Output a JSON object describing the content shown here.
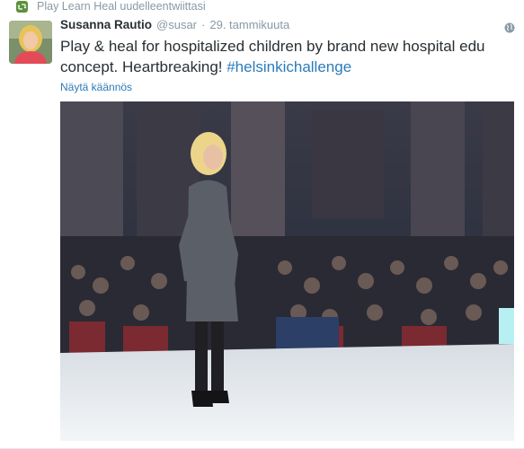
{
  "retweet": {
    "text": "Play Learn Heal uudelleentwiittasi"
  },
  "tweet": {
    "fullname": "Susanna Rautio",
    "username": "@susar",
    "separator": "·",
    "time": "29. tammikuuta",
    "text_main": "Play & heal for hospitalized children by brand new hospital edu concept. Heartbreaking! ",
    "hashtag": "#helsinkichallenge",
    "translate_label": "Näytä käännös"
  },
  "icons": {
    "retweet": "retweet-icon",
    "globe": "globe-icon"
  },
  "colors": {
    "link": "#2b7bb9",
    "muted": "#8899a6",
    "text": "#292f33",
    "retweet_green": "#5c913b"
  }
}
